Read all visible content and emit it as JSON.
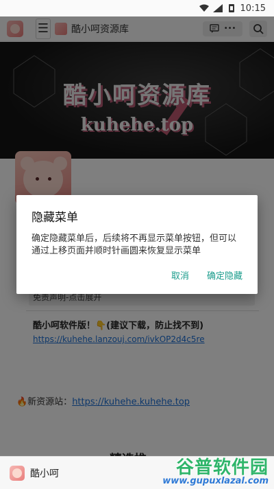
{
  "status_bar": {
    "time": "10:15"
  },
  "app_bar": {
    "title": "酷小呵资源库",
    "menu_glyph": "☰",
    "more_glyph": "•••",
    "chat_icon": "chat-icon",
    "search_icon": "search-icon"
  },
  "banner": {
    "title": "酷小呵资源库",
    "subtitle": "kuhehe.top"
  },
  "page": {
    "notice": "免责声明-点击展开",
    "info_title": "酷小呵软件版！👇(建议下载，防止找不到)",
    "info_link": "https://kuhehe.lanzouj.com/ivkOP2d4c5re",
    "new_site_label": "🔥新资源站：",
    "new_site_link": "https://kuhehe.kuhehe.top",
    "featured_heading": "精选推"
  },
  "dialog": {
    "title": "隐藏菜单",
    "message": "确定隐藏菜单后，后续将不再显示菜单按钮，但可以通过上移页面并顺时针画圆来恢复显示菜单",
    "cancel_label": "取消",
    "confirm_label": "确定隐藏"
  },
  "bottom_bar": {
    "name": "酷小呵"
  },
  "watermark": {
    "main": "谷普软件园",
    "sub": "www.gupuxlazal.com"
  },
  "colors": {
    "accent": "#1a9c8c",
    "link": "#1a6fd6",
    "watermark_green": "#2fb56a"
  }
}
